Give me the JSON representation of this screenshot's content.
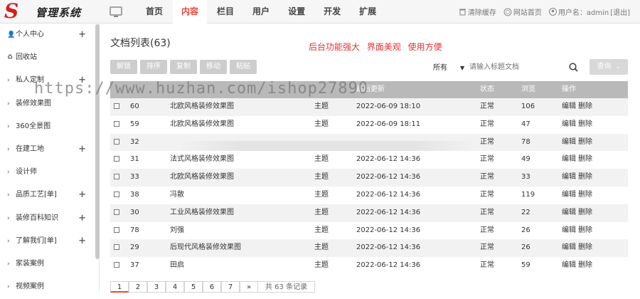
{
  "app": {
    "logo_text": "管理系统",
    "nav": [
      "首页",
      "内容",
      "栏目",
      "用户",
      "设置",
      "开发",
      "扩展"
    ],
    "active_nav": "内容",
    "clear_cache": "清除缓存",
    "site_home": "网站首页",
    "user_label": "用户名：admin",
    "logout": "[退出]"
  },
  "sidebar": {
    "items": [
      {
        "label": "个人中心",
        "prefix": "person-icon",
        "plus": true
      },
      {
        "label": "回收站",
        "prefix": "recycle-icon",
        "plus": false
      },
      {
        "label": "私人定制",
        "prefix": "›",
        "plus": true
      },
      {
        "label": "装修效果图",
        "prefix": "›",
        "plus": false
      },
      {
        "label": "360全景图",
        "prefix": "›",
        "plus": false
      },
      {
        "label": "在建工地",
        "prefix": "›",
        "plus": true
      },
      {
        "label": "设计师",
        "prefix": "›",
        "plus": false
      },
      {
        "label": "品质工艺[单]",
        "prefix": "›",
        "plus": true
      },
      {
        "label": "装修百科知识",
        "prefix": "›",
        "plus": true
      },
      {
        "label": "了解我们[单]",
        "prefix": "›",
        "plus": true
      },
      {
        "label": "家装案例",
        "prefix": "›",
        "plus": false
      },
      {
        "label": "视频案例",
        "prefix": "›",
        "plus": false
      }
    ],
    "plus_symbol": "+"
  },
  "main": {
    "title": "文档列表(63)",
    "promo": "后台功能强大  界面美观  使用方便",
    "toolbar": [
      "解锁",
      "排序",
      "复制",
      "移动",
      "粘贴"
    ],
    "filter": "所有",
    "search_placeholder": "请输入标题文档",
    "search_button": "查询",
    "watermark": "https://www.huzhan.com/ishop27890"
  },
  "table": {
    "headers": {
      "title": "",
      "time": "最后更新",
      "status": "状态",
      "views": "浏览",
      "ops": "操作"
    },
    "rows": [
      {
        "id": "60",
        "title": "北欧风格装修效果图",
        "type": "主题",
        "time": "2022-06-09 18:10",
        "status": "正常",
        "views": "106"
      },
      {
        "id": "59",
        "title": "北欧风格装修效果图",
        "type": "主题",
        "time": "2022-06-09 18:11",
        "status": "正常",
        "views": "47"
      },
      {
        "id": "32",
        "title": "",
        "type": "",
        "time": "",
        "status": "正常",
        "views": "78"
      },
      {
        "id": "31",
        "title": "法式风格装修效果图",
        "type": "主题",
        "time": "2022-06-12 14:36",
        "status": "正常",
        "views": "49"
      },
      {
        "id": "33",
        "title": "北欧风格装修效果图",
        "type": "主题",
        "time": "2022-06-12 14:36",
        "status": "正常",
        "views": "33"
      },
      {
        "id": "38",
        "title": "冯散",
        "type": "主题",
        "time": "2022-06-12 14:36",
        "status": "正常",
        "views": "119"
      },
      {
        "id": "30",
        "title": "工业风格装修效果图",
        "type": "主题",
        "time": "2022-06-12 14:36",
        "status": "正常",
        "views": "22"
      },
      {
        "id": "78",
        "title": "刘强",
        "type": "主题",
        "time": "2022-06-12 14:36",
        "status": "正常",
        "views": "26"
      },
      {
        "id": "29",
        "title": "后现代风格装修效果图",
        "type": "主题",
        "time": "2022-06-12 14:36",
        "status": "正常",
        "views": "26"
      },
      {
        "id": "37",
        "title": "田启",
        "type": "主题",
        "time": "2022-06-12 14:36",
        "status": "正常",
        "views": "59"
      }
    ],
    "edit": "编辑",
    "delete": "删除"
  },
  "pagination": {
    "pages": [
      "1",
      "2",
      "3",
      "4",
      "5",
      "6",
      "7",
      "»"
    ],
    "current": "1",
    "total": "共 63 条记录"
  },
  "colors": {
    "accent": "#e8463a",
    "promo": "#e53030",
    "header_bg": "#b9b9b9"
  }
}
